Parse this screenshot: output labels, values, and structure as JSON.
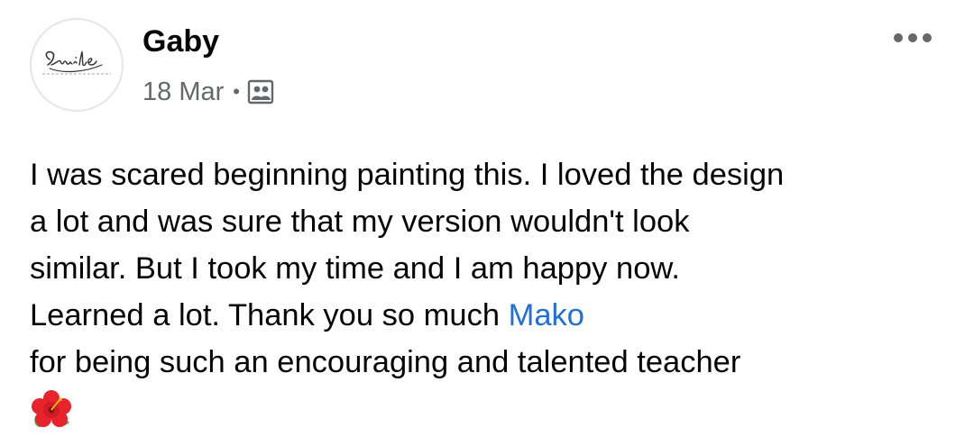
{
  "post": {
    "author": "Gaby",
    "date": "18 Mar",
    "separator": "•",
    "audience_icon": "friends-except-icon",
    "avatar_logo": {
      "word": "Smile",
      "tagline": "happy looks good on you"
    },
    "text_lines": [
      "I was scared beginning painting this. I loved the design",
      "a lot and was sure that my version wouldn't look",
      "similar. But I took my time and I am happy now.",
      "Learned a lot. Thank you so much "
    ],
    "mention": "Mako",
    "last_line": "for being such an encouraging and talented teacher",
    "emoji_icon": "hibiscus-icon"
  },
  "colors": {
    "mention": "#216fdb",
    "meta": "#65676b",
    "text": "#050505"
  }
}
